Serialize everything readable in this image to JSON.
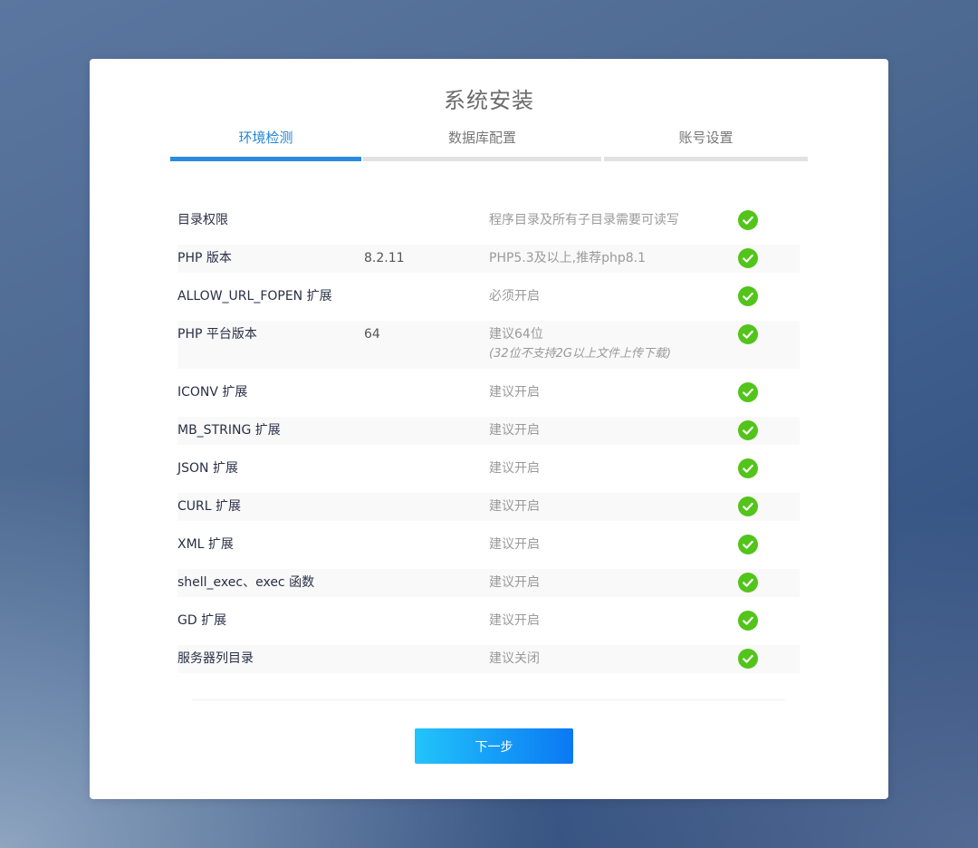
{
  "page": {
    "title": "系统安装"
  },
  "steps": [
    {
      "label": "环境检测",
      "active": true
    },
    {
      "label": "数据库配置",
      "active": false
    },
    {
      "label": "账号设置",
      "active": false
    }
  ],
  "checks": [
    {
      "name": "目录权限",
      "value": "",
      "requirement": "程序目录及所有子目录需要可读写",
      "note": "",
      "status": "pass"
    },
    {
      "name": "PHP 版本",
      "value": "8.2.11",
      "requirement": "PHP5.3及以上,推荐php8.1",
      "note": "",
      "status": "pass"
    },
    {
      "name": "ALLOW_URL_FOPEN 扩展",
      "value": "",
      "requirement": "必须开启",
      "note": "",
      "status": "pass"
    },
    {
      "name": "PHP 平台版本",
      "value": "64",
      "requirement": "建议64位",
      "note": "(32位不支持2G以上文件上传下载)",
      "status": "pass"
    },
    {
      "name": "ICONV 扩展",
      "value": "",
      "requirement": "建议开启",
      "note": "",
      "status": "pass"
    },
    {
      "name": "MB_STRING 扩展",
      "value": "",
      "requirement": "建议开启",
      "note": "",
      "status": "pass"
    },
    {
      "name": "JSON 扩展",
      "value": "",
      "requirement": "建议开启",
      "note": "",
      "status": "pass"
    },
    {
      "name": "CURL 扩展",
      "value": "",
      "requirement": "建议开启",
      "note": "",
      "status": "pass"
    },
    {
      "name": "XML 扩展",
      "value": "",
      "requirement": "建议开启",
      "note": "",
      "status": "pass"
    },
    {
      "name": "shell_exec、exec 函数",
      "value": "",
      "requirement": "建议开启",
      "note": "",
      "status": "pass"
    },
    {
      "name": "GD 扩展",
      "value": "",
      "requirement": "建议开启",
      "note": "",
      "status": "pass"
    },
    {
      "name": "服务器列目录",
      "value": "",
      "requirement": "建议关闭",
      "note": "",
      "status": "pass"
    }
  ],
  "actions": {
    "next_label": "下一步"
  },
  "icons": {
    "status": "check-circle-icon"
  },
  "colors": {
    "accent": "#2b8be4",
    "pass": "#52c41a",
    "button_start": "#22c4fb",
    "button_end": "#0b78f3"
  }
}
